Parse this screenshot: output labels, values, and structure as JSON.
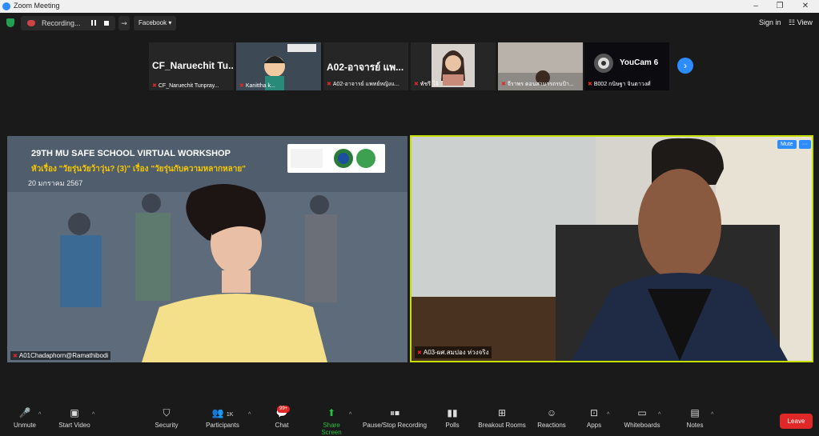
{
  "window": {
    "title": "Zoom Meeting"
  },
  "topbar": {
    "recording_label": "Recording...",
    "stream_destination": "Facebook",
    "signin_label": "Sign in",
    "view_label": "View"
  },
  "strip": [
    {
      "big_label": "CF_Naruechit  Tu...",
      "name": "CF_Naruechit Tunpray..."
    },
    {
      "big_label": "",
      "name": "Kanittha k..."
    },
    {
      "big_label": "A02-อาจารย์ แพ...",
      "name": "A02-อาจารย์ แพทย์หญิงแ..."
    },
    {
      "big_label": "",
      "name": "พัชรี โจ้"
    },
    {
      "big_label": "",
      "name": "จีราพร ดอนสามารถรบป้า..."
    },
    {
      "big_label": "",
      "name": "B002 กนิษฐา จินตาวงศ์",
      "overlay": "YouCam 6"
    }
  ],
  "main_left": {
    "name": "A01Chadaphorn@Ramathibodi",
    "slide_title": "29TH MU SAFE SCHOOL VIRTUAL WORKSHOP",
    "slide_subtitle": "หัวเรื่อง \"วัยรุ่นวัยว้าวุ่น? (3)\" เรื่อง \"วัยรุ่นกับความหลากหลาย\"",
    "slide_date": "20 มกราคม 2567"
  },
  "main_right": {
    "name": "A03-ผศ.สมปอง ห่วงจริง",
    "mute_label": "Mute",
    "more_label": "···"
  },
  "toolbar": {
    "unmute": "Unmute",
    "start_video": "Start Video",
    "security": "Security",
    "participants": "Participants",
    "participants_count": "1K",
    "chat": "Chat",
    "chat_badge": "99+",
    "share_screen": "Share Screen",
    "pause_stop_recording": "Pause/Stop Recording",
    "polls": "Polls",
    "breakout_rooms": "Breakout Rooms",
    "reactions": "Reactions",
    "apps": "Apps",
    "whiteboards": "Whiteboards",
    "notes": "Notes",
    "leave": "Leave"
  }
}
